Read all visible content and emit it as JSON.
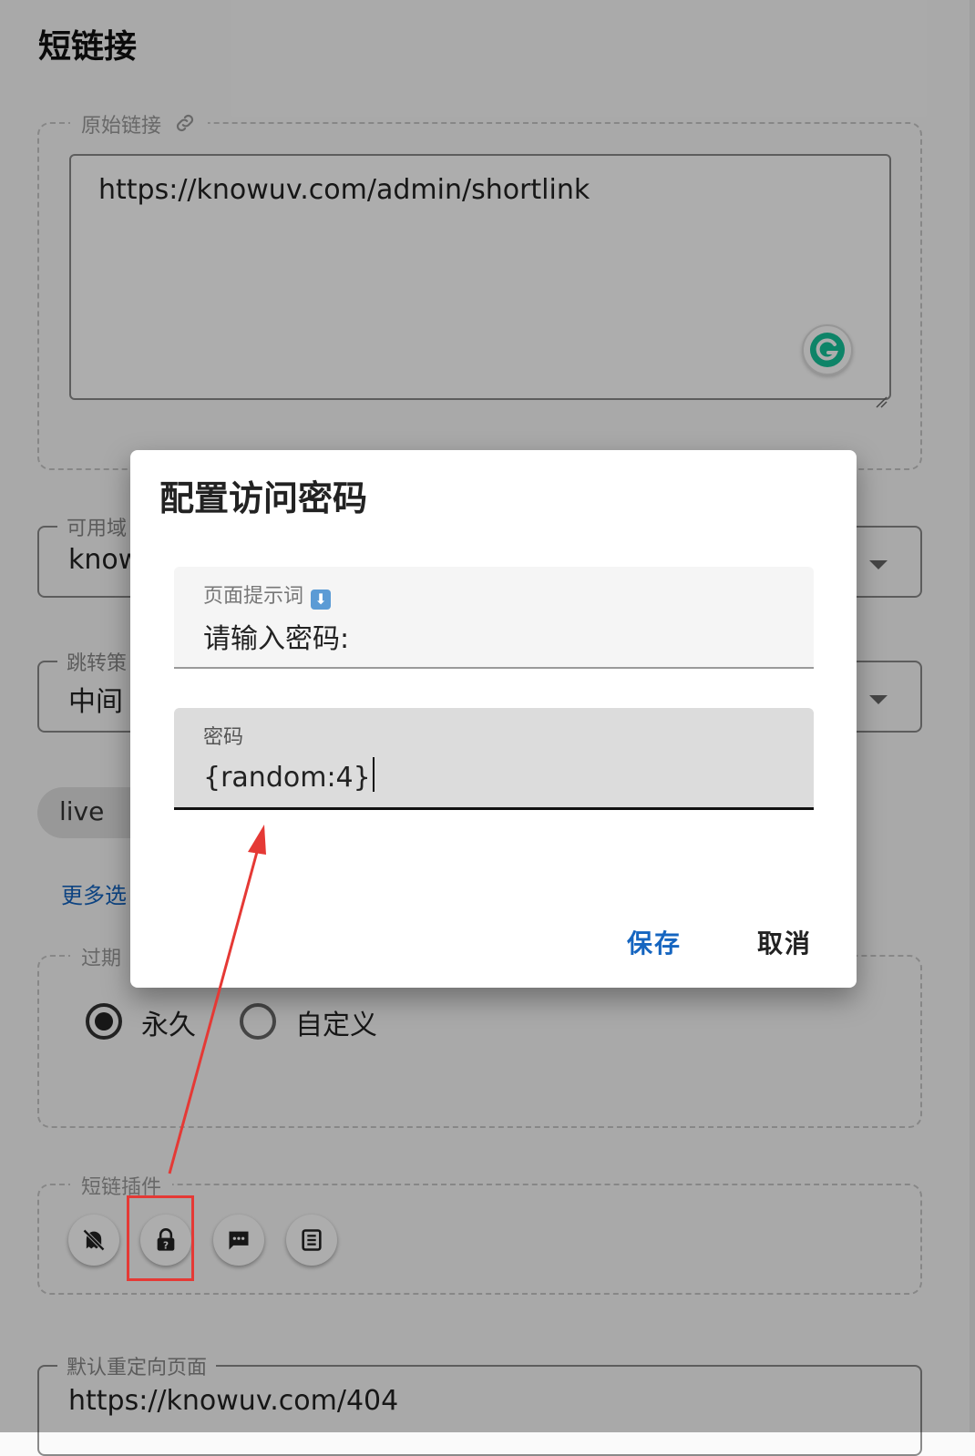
{
  "page": {
    "title": "短链接"
  },
  "original_link": {
    "legend": "原始链接",
    "value": "https://knowuv.com/admin/shortlink"
  },
  "domain_select": {
    "label": "可用域",
    "value": "know"
  },
  "redirect_select": {
    "label": "跳转策",
    "value": "中间"
  },
  "tag_chip": {
    "label": "live"
  },
  "more_options": {
    "label": "更多选"
  },
  "expiry": {
    "legend": "过期",
    "options": [
      "永久",
      "自定义"
    ],
    "selected": "永久"
  },
  "plugins": {
    "legend": "短链插件",
    "buttons": [
      "ghost-off-icon",
      "lock-question-icon",
      "message-dots-icon",
      "text-box-icon"
    ]
  },
  "default_redirect": {
    "label": "默认重定向页面",
    "value": "https://knowuv.com/404"
  },
  "dialog": {
    "title": "配置访问密码",
    "hint_field": {
      "label": "页面提示词",
      "value": "请输入密码:"
    },
    "password_field": {
      "label": "密码",
      "value": "{random:4}"
    },
    "save_label": "保存",
    "cancel_label": "取消"
  },
  "colors": {
    "accent": "#1565c0",
    "highlight": "#e53935",
    "grammarly": "#15c39a"
  }
}
